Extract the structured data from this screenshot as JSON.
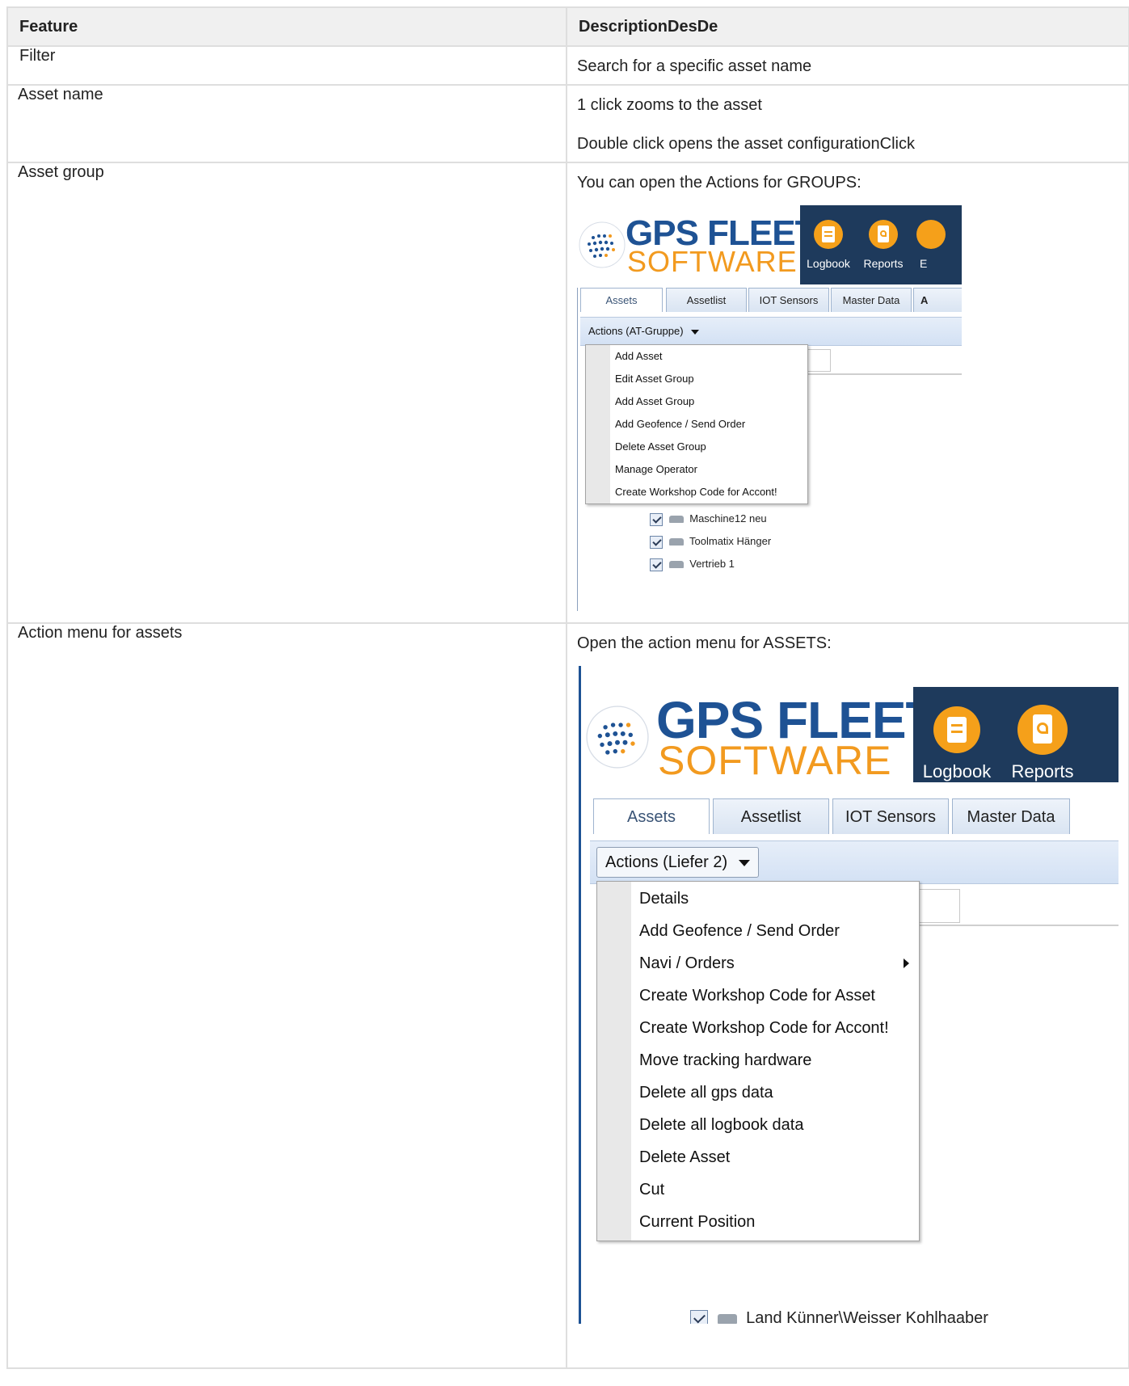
{
  "table": {
    "headers": [
      "Feature",
      "DescriptionDesDe"
    ],
    "rows": [
      {
        "feature": "Filter",
        "desc": [
          "Search for a specific asset name"
        ]
      },
      {
        "feature": "Asset name",
        "desc": [
          "1 click zooms to the asset",
          "Double click opens the asset configurationClick"
        ]
      },
      {
        "feature": "Asset group",
        "desc": [
          "You can open the Actions for GROUPS:"
        ]
      },
      {
        "feature": "Action menu for assets",
        "desc": [
          "Open the action menu for ASSETS:"
        ]
      }
    ]
  },
  "logo": {
    "line1": "GPS FLEET",
    "line2": "SOFTWARE"
  },
  "shot_groups": {
    "nav": [
      "Logbook",
      "Reports",
      "E"
    ],
    "tabs": [
      "Assets",
      "Assetlist",
      "IOT Sensors",
      "Master Data",
      "A"
    ],
    "actions_label": "Actions (AT-Gruppe)",
    "menu": [
      "Add Asset",
      "Edit Asset Group",
      "Add Asset Group",
      "Add Geofence / Send Order",
      "Delete Asset Group",
      "Manage Operator",
      "Create Workshop Code for Accont!"
    ],
    "tree": [
      "Maschine12 neu",
      "Toolmatix Hänger",
      "Vertrieb 1"
    ]
  },
  "shot_assets": {
    "nav": [
      "Logbook",
      "Reports"
    ],
    "tabs": [
      "Assets",
      "Assetlist",
      "IOT Sensors",
      "Master Data"
    ],
    "actions_label": "Actions (Liefer 2)",
    "menu": [
      "Details",
      "Add Geofence / Send Order",
      "Navi / Orders",
      "Create Workshop Code for Asset",
      "Create Workshop Code for Accont!",
      "Move tracking hardware",
      "Delete all gps data",
      "Delete all logbook data",
      "Delete Asset",
      "Cut",
      "Current Position"
    ],
    "tree_partial": "Land Künner\\Weisser Kohlhaaber"
  },
  "colors": {
    "brand_blue": "#1e5294",
    "brand_orange": "#f29a1f",
    "navbar": "#1e3a5c"
  },
  "icons": [
    "book-icon",
    "pdf-icon",
    "dropdown-arrow-icon",
    "submenu-arrow-icon",
    "checkbox-icon",
    "car-icon",
    "globe-logo-icon"
  ]
}
